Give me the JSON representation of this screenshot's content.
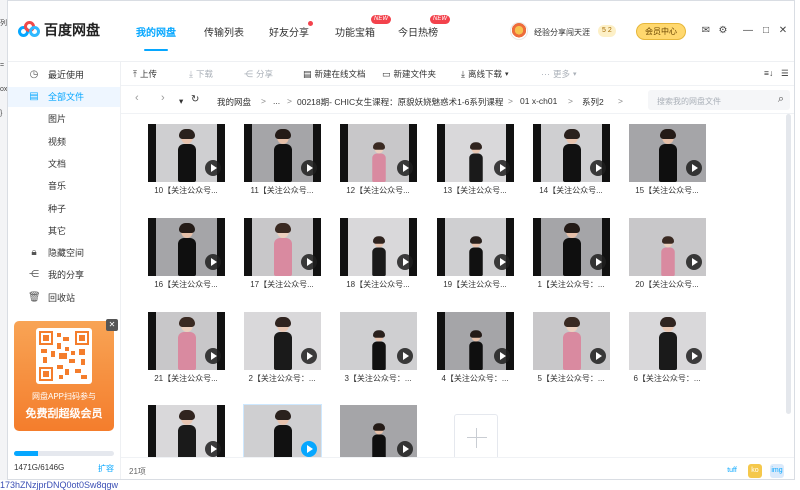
{
  "app": {
    "title": "百度网盘"
  },
  "nav": {
    "tabs": [
      {
        "label": "我的网盘",
        "active": true
      },
      {
        "label": "传输列表"
      },
      {
        "label": "好友分享",
        "dot": true
      },
      {
        "label": "功能宝箱",
        "badge": "NEW"
      },
      {
        "label": "今日热榜",
        "badge": "NEW"
      }
    ]
  },
  "user": {
    "name": "经验分享闯天涯",
    "coins": "5 2",
    "vip": "会员中心"
  },
  "window_controls": {
    "mail": "✉",
    "settings": "⚙",
    "minimize": "—",
    "maximize": "□",
    "close": "✕"
  },
  "sidebar": {
    "items": [
      {
        "label": "最近使用",
        "icon": "clock-icon",
        "glyph": "◷"
      },
      {
        "label": "全部文件",
        "icon": "file-icon",
        "glyph": "▤",
        "active": true
      },
      {
        "label": "图片"
      },
      {
        "label": "视频"
      },
      {
        "label": "文档"
      },
      {
        "label": "音乐"
      },
      {
        "label": "种子"
      },
      {
        "label": "其它"
      },
      {
        "label": "隐藏空间",
        "icon": "lock-icon",
        "glyph": "🔒︎"
      },
      {
        "label": "我的分享",
        "icon": "share-icon",
        "glyph": "⋲"
      },
      {
        "label": "回收站",
        "icon": "trash-icon",
        "glyph": "🗑︎"
      }
    ],
    "promo": {
      "line1": "网盘APP扫码参与",
      "line2": "免费刮超级会员",
      "close": "✕"
    },
    "quota": {
      "text": "1471G/6146G",
      "used_fraction": 0.24,
      "expand": "扩容"
    }
  },
  "toolbar": {
    "items": [
      {
        "label": "上传",
        "glyph": "⤒",
        "icon": "upload-icon"
      },
      {
        "label": "下载",
        "glyph": "⤓",
        "icon": "download-icon",
        "disabled": true
      },
      {
        "label": "分享",
        "glyph": "⋲",
        "icon": "share-icon",
        "disabled": true
      },
      {
        "label": "新建在线文档",
        "glyph": "▤",
        "icon": "doc-icon"
      },
      {
        "label": "新建文件夹",
        "glyph": "▭",
        "icon": "folder-icon"
      },
      {
        "label": "离线下载",
        "glyph": "⤓",
        "icon": "offline-download-icon"
      },
      {
        "label": "更多",
        "glyph": "···",
        "icon": "more-icon",
        "disabled": true
      }
    ],
    "sort": "≡↓",
    "view": "☰"
  },
  "path": {
    "back": "‹",
    "forward": "›",
    "history": "▾",
    "refresh": "↻",
    "crumbs": [
      "我的网盘",
      "...",
      "00218期- CHIC女生课程：原貌妖娆魅惑术1-6系列课程",
      "01 x-ch01",
      "系列2"
    ],
    "search_placeholder": "搜索我的网盘文件",
    "search_glyph": "⌕"
  },
  "files": [
    "10【关注公众号...",
    "11【关注公众号...",
    "12【关注公众号...",
    "13【关注公众号...",
    "14【关注公众号...",
    "15【关注公众号...",
    "16【关注公众号...",
    "17【关注公众号...",
    "18【关注公众号...",
    "19【关注公众号...",
    "1【关注公众号：...",
    "20【关注公众号...",
    "21【关注公众号...",
    "2【关注公众号：...",
    "3【关注公众号：...",
    "4【关注公众号：...",
    "5【关注公众号：...",
    "6【关注公众号：...",
    "",
    "",
    ""
  ],
  "footer": {
    "count": "21项",
    "icons": [
      "tuff",
      "ko",
      "img"
    ]
  },
  "background": {
    "bottom_text": "173hZNzjprDNQ0ot0Sw8qgw"
  }
}
